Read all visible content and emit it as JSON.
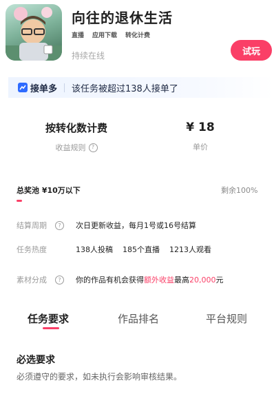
{
  "header": {
    "app_title": "向往的退休生活",
    "tags": [
      "直播",
      "应用下载",
      "转化计费"
    ],
    "online_status": "持续在线",
    "try_button": "试玩"
  },
  "banner": {
    "brand": "接单多",
    "text": "该任务被超过138人接单了",
    "accent_color": "#2f6bff"
  },
  "metrics": {
    "billing": {
      "value": "按转化数计费",
      "label": "收益规则"
    },
    "price": {
      "value": "¥ 18",
      "label": "单价"
    }
  },
  "pool": {
    "label": "总奖池 ¥10万以下",
    "remaining": "剩余100%",
    "fill_fraction": 0.02
  },
  "details": [
    {
      "label": "结算周期",
      "value": "次日更新收益，每月1号或16号结算"
    },
    {
      "label": "任务热度",
      "values": [
        "138人投稿",
        "185个直播",
        "1213人观看"
      ]
    },
    {
      "label": "素材分成",
      "value_prefix": "你的作品有机会获得",
      "value_highlight": "额外收益",
      "value_mid": "最高",
      "value_amount": "20,000",
      "value_suffix": "元"
    }
  ],
  "tabs": [
    "任务要求",
    "作品排名",
    "平台规则"
  ],
  "active_tab": "任务要求",
  "requirements": {
    "title": "必选要求",
    "description": "必须遵守的要求，如未执行会影响审核结果。"
  },
  "colors": {
    "accent": "#fa3f67"
  }
}
